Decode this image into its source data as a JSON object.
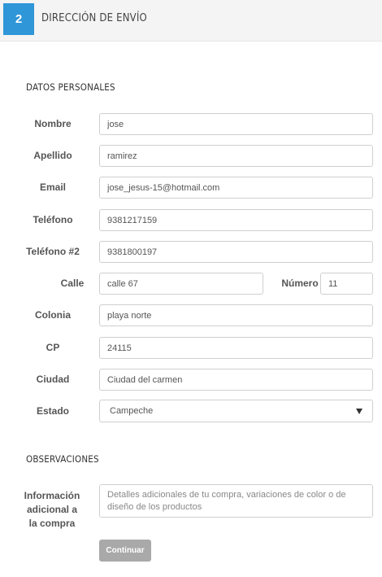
{
  "header": {
    "step": "2",
    "title": "DIRECCIÓN DE ENVÍO"
  },
  "personal": {
    "title": "DATOS PERSONALES",
    "nombre": {
      "label": "Nombre",
      "value": "jose"
    },
    "apellido": {
      "label": "Apellido",
      "value": "ramirez"
    },
    "email": {
      "label": "Email",
      "value": "jose_jesus-15@hotmail.com"
    },
    "telefono": {
      "label": "Teléfono",
      "value": "9381217159"
    },
    "telefono2": {
      "label": "Teléfono #2",
      "value": "9381800197"
    },
    "calle": {
      "label": "Calle",
      "value": "calle 67"
    },
    "numero": {
      "label": "Número",
      "value": "11"
    },
    "colonia": {
      "label": "Colonia",
      "value": "playa norte"
    },
    "cp": {
      "label": "CP",
      "value": "24115"
    },
    "ciudad": {
      "label": "Ciudad",
      "value": "Ciudad del carmen"
    },
    "estado": {
      "label": "Estado",
      "value": "Campeche"
    }
  },
  "observaciones": {
    "title": "OBSERVACIONES",
    "label_line1": "Información",
    "label_line2": "adicional a",
    "label_line3": "la compra",
    "placeholder": "Detalles adicionales de tu compra, variaciones de color o de diseño de los productos"
  },
  "submit_label": "Continuar",
  "colors": {
    "accent": "#2f96d8",
    "button": "#a9a9a9"
  }
}
